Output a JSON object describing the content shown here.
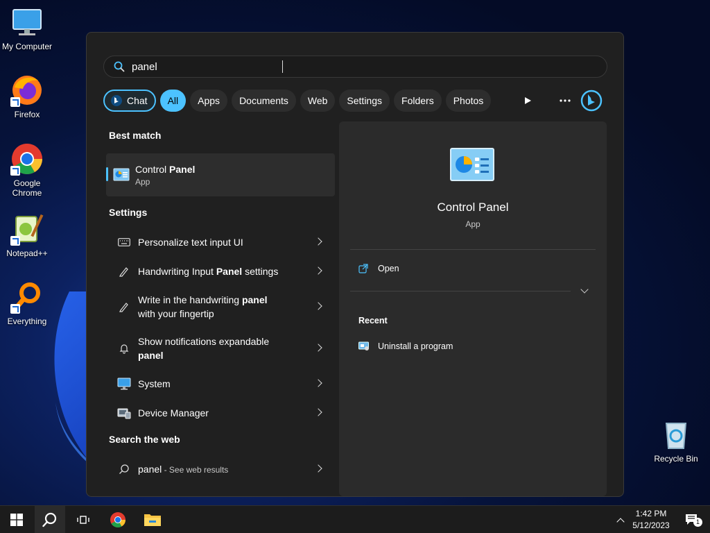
{
  "desktop": {
    "icons": [
      {
        "label": "My Computer"
      },
      {
        "label": "Firefox"
      },
      {
        "label": "Google Chrome"
      },
      {
        "label": "Notepad++"
      },
      {
        "label": "Everything"
      },
      {
        "label": "Recycle Bin"
      }
    ]
  },
  "search": {
    "value": "panel"
  },
  "filters": {
    "chat": "Chat",
    "all": "All",
    "apps": "Apps",
    "documents": "Documents",
    "web": "Web",
    "settings": "Settings",
    "folders": "Folders",
    "photos": "Photos"
  },
  "results": {
    "best_match_title": "Best match",
    "best_match": {
      "name_pre": "Control ",
      "name_bold": "Panel",
      "type": "App"
    },
    "settings_title": "Settings",
    "settings": [
      {
        "pre": "Personalize text input UI",
        "bold": "",
        "post": "",
        "line2_pre": "",
        "line2_bold": ""
      },
      {
        "pre": "Handwriting Input ",
        "bold": "Panel",
        "post": " settings",
        "line2_pre": "",
        "line2_bold": ""
      },
      {
        "pre": "Write in the handwriting ",
        "bold": "panel",
        "post": "",
        "line2_pre": "with your fingertip",
        "line2_bold": ""
      },
      {
        "pre": "Show notifications expandable",
        "bold": "",
        "post": "",
        "line2_pre": "",
        "line2_bold": "panel"
      },
      {
        "pre": "System",
        "bold": "",
        "post": "",
        "line2_pre": "",
        "line2_bold": ""
      },
      {
        "pre": "Device Manager",
        "bold": "",
        "post": "",
        "line2_pre": "",
        "line2_bold": ""
      }
    ],
    "web_title": "Search the web",
    "web": {
      "query": "panel",
      "suffix": " - See web results"
    }
  },
  "details": {
    "app_name": "Control Panel",
    "app_type": "App",
    "open_label": "Open",
    "recent_title": "Recent",
    "recent": [
      {
        "label": "Uninstall a program"
      }
    ]
  },
  "taskbar": {
    "time": "1:42 PM",
    "date": "5/12/2023",
    "notification_count": "1"
  },
  "colors": {
    "accent": "#4cc2ff",
    "panel_bg": "#202020",
    "taskbar_bg": "#1c1c1c"
  }
}
